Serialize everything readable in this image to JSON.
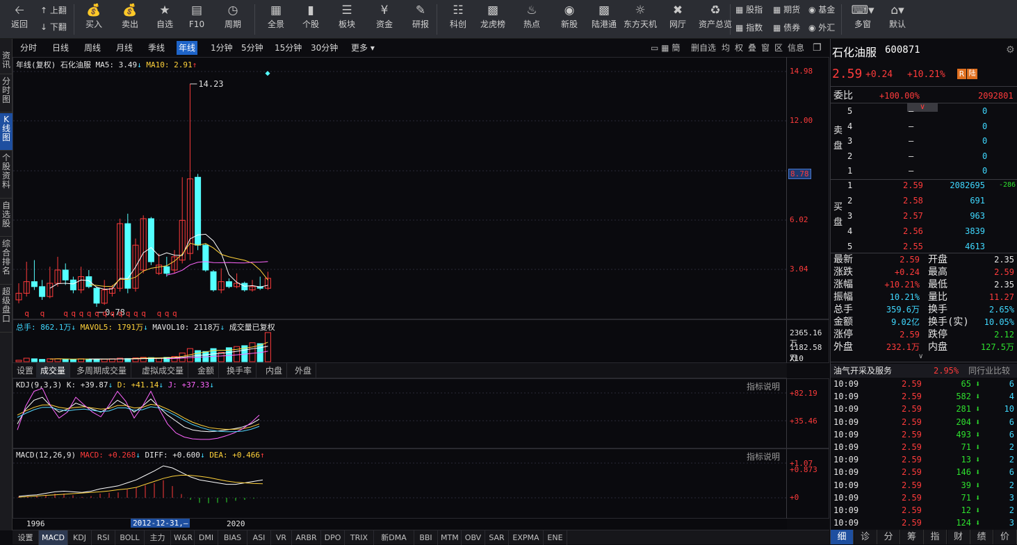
{
  "toolbar": {
    "back": "返回",
    "page_up": "上翻",
    "page_down": "下翻",
    "buttons": [
      "买入",
      "卖出",
      "自选",
      "F10",
      "周期",
      "全景",
      "个股",
      "板块",
      "资金",
      "研报",
      "科创",
      "龙虎榜",
      "热点",
      "新股",
      "陆港通",
      "东方天机",
      "网厅",
      "资产总览"
    ],
    "small_items": [
      "股指",
      "期货",
      "基金",
      "指数",
      "债券",
      "外汇"
    ],
    "multi_window": "多窗",
    "default": "默认"
  },
  "left_tabs": [
    "资讯",
    "分时图",
    "K线图",
    "个股资料",
    "自选股",
    "综合排名",
    "超级盘口"
  ],
  "period_tabs": [
    "分时",
    "日线",
    "周线",
    "月线",
    "季线",
    "年线",
    "1分钟",
    "5分钟",
    "15分钟",
    "30分钟",
    "更多"
  ],
  "right_tools": [
    "删自选",
    "均",
    "权",
    "叠",
    "窗",
    "区",
    "信息"
  ],
  "kline": {
    "title": "年线(复权)",
    "name": "石化油服",
    "ma5": "MA5: 3.49",
    "ma10": "MA10: 2.91",
    "y_labels": [
      "14.98",
      "12.00",
      "8.78",
      "6.02",
      "3.04"
    ],
    "high_label": "14.23",
    "low_label": "0.78",
    "current_label": "8.78"
  },
  "volume": {
    "total": "总手: 862.1万",
    "mavol5": "MAVOL5: 1791万",
    "mavol10": "MAVOL10: 2118万",
    "note": "成交量已复权",
    "y_labels": [
      "2365.16万",
      "1182.58万",
      "X10"
    ]
  },
  "vol_tabs": [
    "设置",
    "成交量",
    "多周期成交量",
    "虚拟成交量",
    "金额",
    "换手率",
    "内盘",
    "外盘"
  ],
  "kdj": {
    "label": "KDJ(9,3,3)",
    "k": "K: +39.87",
    "d": "D: +41.14",
    "j": "J: +37.33",
    "help": "指标说明",
    "y_labels": [
      "+82.19",
      "+35.46"
    ]
  },
  "macd": {
    "label": "MACD(12,26,9)",
    "macd": "MACD: +0.268",
    "diff": "DIFF: +0.600",
    "dea": "DEA: +0.466",
    "help": "指标说明",
    "y_labels": [
      "+1.07",
      "+0.873",
      "+0"
    ]
  },
  "x_axis": {
    "left": "1996",
    "cursor": "2012-12-31,—",
    "right": "2020"
  },
  "bottom_tabs": [
    "设置",
    "MACD",
    "KDJ",
    "RSI",
    "BOLL",
    "主力",
    "W&R",
    "DMI",
    "BIAS",
    "ASI",
    "VR",
    "ARBR",
    "DPO",
    "TRIX",
    "新DMA",
    "BBI",
    "MTM",
    "OBV",
    "SAR",
    "EXPMA",
    "ENE"
  ],
  "stock": {
    "name": "石化油服",
    "code": "600871",
    "price": "2.59",
    "change": "+0.24",
    "pct": "+10.21%",
    "badge_r": "R",
    "badge_lu": "陆"
  },
  "weibi": {
    "label": "委比",
    "pct": "+100.00%",
    "diff": "2092801"
  },
  "sell_side": {
    "label": "卖盘",
    "rows": [
      [
        "5",
        "—",
        "0"
      ],
      [
        "4",
        "—",
        "0"
      ],
      [
        "3",
        "—",
        "0"
      ],
      [
        "2",
        "—",
        "0"
      ],
      [
        "1",
        "—",
        "0"
      ]
    ]
  },
  "buy_side": {
    "label": "买盘",
    "rows": [
      [
        "1",
        "2.59",
        "2082695",
        "-286"
      ],
      [
        "2",
        "2.58",
        "691",
        ""
      ],
      [
        "3",
        "2.57",
        "963",
        ""
      ],
      [
        "4",
        "2.56",
        "3839",
        ""
      ],
      [
        "5",
        "2.55",
        "4613",
        ""
      ]
    ]
  },
  "stats": [
    [
      "最新",
      "2.59",
      "开盘",
      "2.35"
    ],
    [
      "涨跌",
      "+0.24",
      "最高",
      "2.59"
    ],
    [
      "涨幅",
      "+10.21%",
      "最低",
      "2.35"
    ],
    [
      "振幅",
      "10.21%",
      "量比",
      "11.27"
    ],
    [
      "总手",
      "359.6万",
      "换手",
      "2.65%"
    ],
    [
      "金额",
      "9.02亿",
      "换手(实)",
      "10.05%"
    ],
    [
      "涨停",
      "2.59",
      "跌停",
      "2.12"
    ],
    [
      "外盘",
      "232.1万",
      "内盘",
      "127.5万"
    ]
  ],
  "industry": {
    "name": "油气开采及服务",
    "pct": "2.95%",
    "compare": "同行业比较"
  },
  "ticks": [
    [
      "10:09",
      "2.59",
      "65",
      "6"
    ],
    [
      "10:09",
      "2.59",
      "582",
      "4"
    ],
    [
      "10:09",
      "2.59",
      "281",
      "10"
    ],
    [
      "10:09",
      "2.59",
      "204",
      "6"
    ],
    [
      "10:09",
      "2.59",
      "493",
      "6"
    ],
    [
      "10:09",
      "2.59",
      "71",
      "2"
    ],
    [
      "10:09",
      "2.59",
      "13",
      "2"
    ],
    [
      "10:09",
      "2.59",
      "146",
      "6"
    ],
    [
      "10:09",
      "2.59",
      "39",
      "2"
    ],
    [
      "10:09",
      "2.59",
      "71",
      "3"
    ],
    [
      "10:09",
      "2.59",
      "12",
      "2"
    ],
    [
      "10:09",
      "2.59",
      "124",
      "3"
    ]
  ],
  "right_bottom_tabs": [
    "细",
    "诊",
    "分",
    "筹",
    "指",
    "财",
    "绩",
    "价"
  ],
  "chart_data": {
    "type": "candlestick",
    "period": "yearly",
    "x_range": [
      "1996",
      "2021"
    ],
    "candles": [
      {
        "o": 1.2,
        "c": 1.6,
        "h": 2.2,
        "l": 1.0,
        "up": true
      },
      {
        "o": 1.6,
        "c": 2.3,
        "h": 3.5,
        "l": 1.4,
        "up": true
      },
      {
        "o": 2.3,
        "c": 2.0,
        "h": 3.6,
        "l": 1.8,
        "up": false
      },
      {
        "o": 2.0,
        "c": 1.4,
        "h": 2.4,
        "l": 1.2,
        "up": false
      },
      {
        "o": 1.4,
        "c": 2.2,
        "h": 3.2,
        "l": 1.3,
        "up": true
      },
      {
        "o": 2.2,
        "c": 3.0,
        "h": 3.8,
        "l": 2.0,
        "up": true
      },
      {
        "o": 3.0,
        "c": 2.4,
        "h": 3.4,
        "l": 2.1,
        "up": false
      },
      {
        "o": 2.4,
        "c": 1.8,
        "h": 2.6,
        "l": 1.6,
        "up": false
      },
      {
        "o": 1.8,
        "c": 2.6,
        "h": 3.2,
        "l": 1.6,
        "up": true
      },
      {
        "o": 2.6,
        "c": 2.0,
        "h": 3.0,
        "l": 1.9,
        "up": false
      },
      {
        "o": 1.9,
        "c": 1.0,
        "h": 2.0,
        "l": 0.78,
        "up": false
      },
      {
        "o": 1.0,
        "c": 1.8,
        "h": 2.4,
        "l": 0.9,
        "up": true
      },
      {
        "o": 1.6,
        "c": 1.9,
        "h": 2.1,
        "l": 1.4,
        "up": true
      },
      {
        "o": 1.9,
        "c": 5.8,
        "h": 6.1,
        "l": 1.7,
        "up": true
      },
      {
        "o": 5.8,
        "c": 1.9,
        "h": 6.4,
        "l": 1.6,
        "up": false
      },
      {
        "o": 1.9,
        "c": 4.5,
        "h": 4.9,
        "l": 1.7,
        "up": true
      },
      {
        "o": 3.0,
        "c": 6.1,
        "h": 6.3,
        "l": 2.8,
        "up": true
      },
      {
        "o": 6.1,
        "c": 3.5,
        "h": 6.2,
        "l": 3.3,
        "up": false
      },
      {
        "o": 2.8,
        "c": 3.3,
        "h": 4.0,
        "l": 2.7,
        "up": true
      },
      {
        "o": 3.2,
        "c": 2.8,
        "h": 3.8,
        "l": 2.6,
        "up": false
      },
      {
        "o": 3.0,
        "c": 3.8,
        "h": 4.2,
        "l": 2.8,
        "up": true
      },
      {
        "o": 3.6,
        "c": 6.0,
        "h": 8.6,
        "l": 3.4,
        "up": true
      },
      {
        "o": 4.0,
        "c": 8.5,
        "h": 14.23,
        "l": 3.6,
        "up": true
      },
      {
        "o": 8.6,
        "c": 4.5,
        "h": 8.8,
        "l": 4.2,
        "up": false
      },
      {
        "o": 4.5,
        "c": 3.0,
        "h": 4.6,
        "l": 2.9,
        "up": false
      },
      {
        "o": 2.9,
        "c": 1.8,
        "h": 3.0,
        "l": 1.7,
        "up": false
      },
      {
        "o": 1.8,
        "c": 2.3,
        "h": 3.1,
        "l": 1.6,
        "up": true
      },
      {
        "o": 2.3,
        "c": 2.0,
        "h": 2.5,
        "l": 1.9,
        "up": false
      },
      {
        "o": 2.0,
        "c": 2.2,
        "h": 2.8,
        "l": 1.9,
        "up": true
      },
      {
        "o": 2.2,
        "c": 1.8,
        "h": 2.3,
        "l": 1.7,
        "up": false
      },
      {
        "o": 1.8,
        "c": 2.0,
        "h": 2.4,
        "l": 1.7,
        "up": true
      },
      {
        "o": 2.0,
        "c": 1.9,
        "h": 2.6,
        "l": 1.8,
        "up": false
      },
      {
        "o": 1.9,
        "c": 2.5,
        "h": 2.9,
        "l": 1.8,
        "up": true
      }
    ],
    "volumes": [
      0.05,
      0.12,
      0.1,
      0.08,
      0.1,
      0.1,
      0.09,
      0.08,
      0.1,
      0.09,
      0.08,
      0.09,
      0.1,
      0.12,
      0.11,
      0.13,
      0.15,
      0.14,
      0.13,
      0.15,
      0.18,
      0.3,
      0.45,
      0.38,
      0.35,
      0.45,
      0.32,
      0.48,
      0.52,
      0.55,
      0.65,
      0.62,
      1.0
    ],
    "vol_up": [
      true,
      true,
      false,
      false,
      true,
      true,
      false,
      false,
      true,
      false,
      false,
      true,
      true,
      true,
      false,
      true,
      true,
      false,
      true,
      false,
      true,
      true,
      true,
      false,
      false,
      false,
      true,
      false,
      true,
      false,
      true,
      false,
      true
    ],
    "kdj_k": [
      30,
      55,
      70,
      75,
      60,
      50,
      55,
      65,
      60,
      55,
      50,
      58,
      70,
      62,
      50,
      60,
      72,
      58,
      45,
      35,
      25,
      20,
      18,
      17,
      18,
      20,
      22,
      25,
      30,
      38
    ],
    "kdj_d": [
      45,
      52,
      58,
      62,
      62,
      58,
      56,
      58,
      59,
      57,
      55,
      56,
      61,
      61,
      57,
      58,
      63,
      61,
      55,
      48,
      40,
      33,
      28,
      24,
      22,
      21,
      21,
      22,
      25,
      30
    ],
    "kdj_j": [
      20,
      60,
      85,
      90,
      60,
      40,
      50,
      75,
      62,
      50,
      42,
      62,
      85,
      68,
      40,
      60,
      85,
      55,
      30,
      15,
      8,
      5,
      4,
      4,
      6,
      10,
      15,
      22,
      32,
      45
    ],
    "macd_diff": [
      0.05,
      0.08,
      0.1,
      0.15,
      0.2,
      0.22,
      0.2,
      0.18,
      0.22,
      0.3,
      0.35,
      0.4,
      0.5,
      0.6,
      0.75,
      0.9,
      1.07,
      1.0,
      0.85,
      0.7,
      0.6,
      0.55,
      0.5,
      0.45,
      0.45,
      0.5,
      0.55,
      0.6
    ],
    "macd_dea": [
      0.02,
      0.04,
      0.06,
      0.08,
      0.1,
      0.12,
      0.14,
      0.16,
      0.18,
      0.2,
      0.23,
      0.27,
      0.3,
      0.35,
      0.45,
      0.55,
      0.65,
      0.72,
      0.76,
      0.75,
      0.72,
      0.68,
      0.62,
      0.56,
      0.52,
      0.5,
      0.48,
      0.47
    ],
    "macd_hist": [
      0.03,
      0.04,
      0.04,
      0.07,
      0.1,
      0.1,
      0.06,
      0.02,
      0.04,
      0.1,
      0.12,
      0.13,
      0.2,
      0.25,
      0.3,
      0.35,
      0.42,
      0.28,
      0.09,
      -0.05,
      -0.12,
      -0.13,
      -0.12,
      -0.11,
      -0.07,
      -0.05,
      -0.02,
      0.0
    ]
  }
}
